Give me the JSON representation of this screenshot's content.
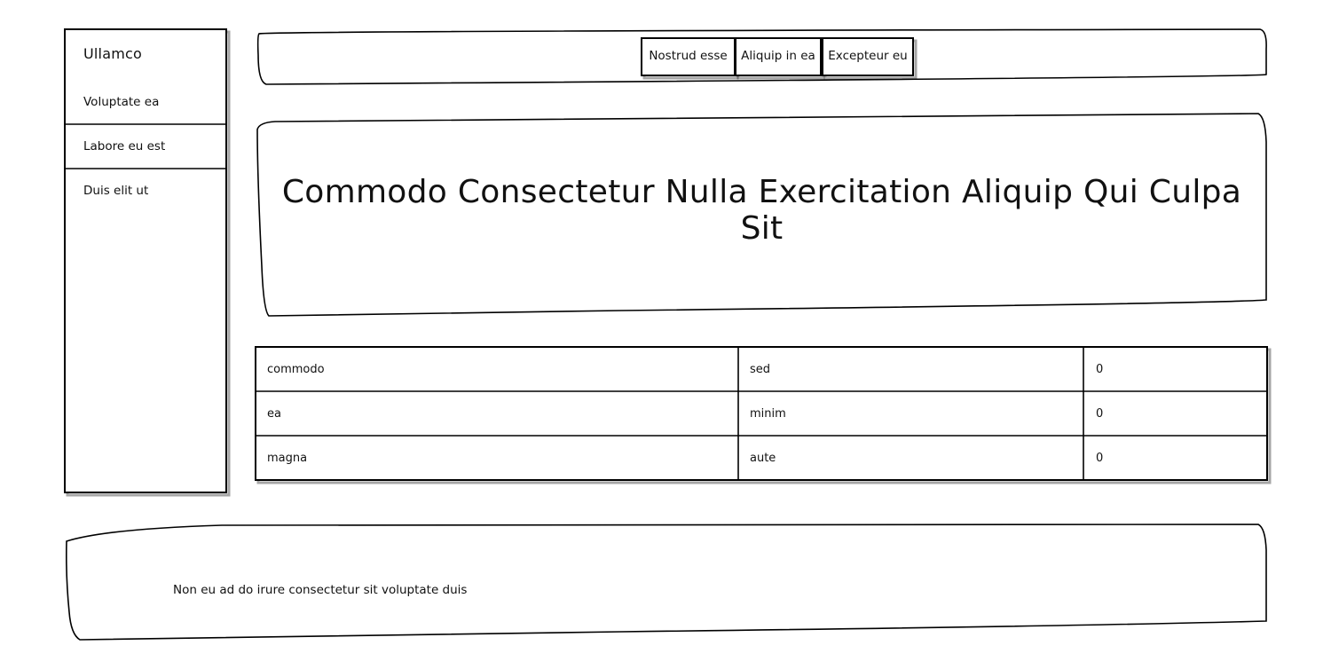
{
  "sidebar": {
    "brand": "Ullamco",
    "items": [
      {
        "label": "Voluptate ea"
      },
      {
        "label": "Labore eu est"
      },
      {
        "label": "Duis elit ut"
      }
    ]
  },
  "topnav": {
    "buttons": [
      {
        "label": "Nostrud esse"
      },
      {
        "label": "Aliquip in ea"
      },
      {
        "label": "Excepteur eu"
      }
    ]
  },
  "hero": {
    "title": "Commodo Consectetur Nulla Exercitation Aliquip Qui Culpa Sit"
  },
  "table": {
    "rows": [
      [
        "commodo",
        "sed",
        "0"
      ],
      [
        "ea",
        "minim",
        "0"
      ],
      [
        "magna",
        "aute",
        "0"
      ]
    ]
  },
  "footer": {
    "text": "Non eu ad do irure consectetur sit voluptate duis"
  }
}
